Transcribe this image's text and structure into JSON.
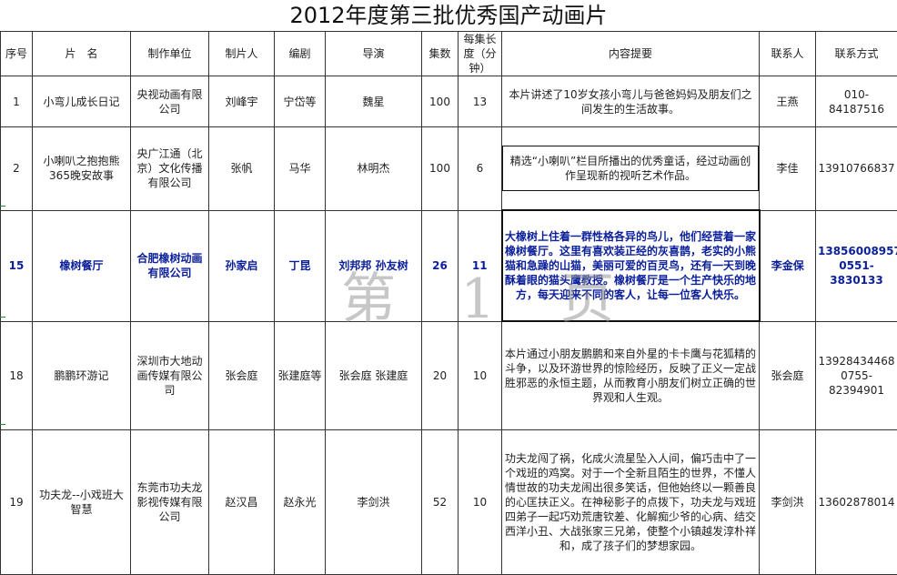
{
  "title": "2012年度第三批优秀国产动画片",
  "watermark": "第 1 页",
  "headers": [
    "序号",
    "片　名",
    "制作单位",
    "制片人",
    "编剧",
    "导演",
    "集数",
    "每集长度（分钟）",
    "内容提要",
    "联系人",
    "联系方式"
  ],
  "rows": [
    {
      "no": "1",
      "name": "小弯儿成长日记",
      "unit": "央视动画有限公司",
      "producer": "刘峰宇",
      "writer": "宁岱等",
      "director": "魏星",
      "episodes": "100",
      "minutes": "13",
      "summary": "本片讲述了10岁女孩小弯儿与爸爸妈妈及朋友们之间发生的生活故事。",
      "contact": "王燕",
      "phone": "010-84187516"
    },
    {
      "no": "2",
      "name": "小喇叭之抱抱熊365晚安故事",
      "unit": "央广江通（北京）文化传播有限公司",
      "producer": "张帆",
      "writer": "马华",
      "director": "林明杰",
      "episodes": "100",
      "minutes": "6",
      "summary": "精选“小喇叭”栏目所播出的优秀童话，经过动画创作呈现新的视听艺术作品。",
      "contact": "李佳",
      "phone": "13910766837"
    },
    {
      "no": "15",
      "name": "橡树餐厅",
      "unit": "合肥橡树动画有限公司",
      "producer": "孙家启",
      "writer": "丁昆",
      "director": "刘邦邦 孙友树",
      "episodes": "26",
      "minutes": "11",
      "summary": "大橡树上住着一群性格各异的鸟儿，他们经营着一家橡树餐厅。这里有喜欢装正经的灰喜鹊，老实的小熊猫和急躁的山猫，美丽可爱的百灵鸟，还有一天到晚酥着眼的猫头鹰教授。橡树餐厅是一个生产快乐的地方，每天迎来不同的客人，让每一位客人快乐。",
      "contact": "李金保",
      "phone": "13856008957 0551-3830133"
    },
    {
      "no": "18",
      "name": "鹏鹏环游记",
      "unit": "深圳市大地动画传媒有限公司",
      "producer": "张会庭",
      "writer": "张建庭等",
      "director": "张会庭 张建庭",
      "episodes": "20",
      "minutes": "10",
      "summary": "本片通过小朋友鹏鹏和来自外星的卡卡鹰与花狐精的斗争，以及环游世界的惊险经历，反映了正义一定战胜邪恶的永恒主题，从而教育小朋友们树立正确的世界观和人生观。",
      "contact": "张会庭",
      "phone": "13928434468 0755-82394901"
    },
    {
      "no": "19",
      "name": "功夫龙--小戏班大智慧",
      "unit": "东莞市功夫龙影视传媒有限公司",
      "producer": "赵汉昌",
      "writer": "赵永光",
      "director": "李剑洪",
      "episodes": "52",
      "minutes": "10",
      "summary": "功夫龙闯了祸，化成火流星坠入人间，偏巧击中了一个戏班的鸡窝。对于一个全新且陌生的世界，不懂人情世故的功夫龙闹出很多笑话，但他始终以一颗善良的心匡扶正义。在神秘影子的点拨下，功夫龙与戏班四弟子一起巧劝荒唐钦差、化解痴少爷的心病、结交西洋小丑、大战张家三兄弟，使整个小镇越发淳朴祥和，成了孩子们的梦想家园。",
      "contact": "李剑洪",
      "phone": "13602878014"
    }
  ]
}
